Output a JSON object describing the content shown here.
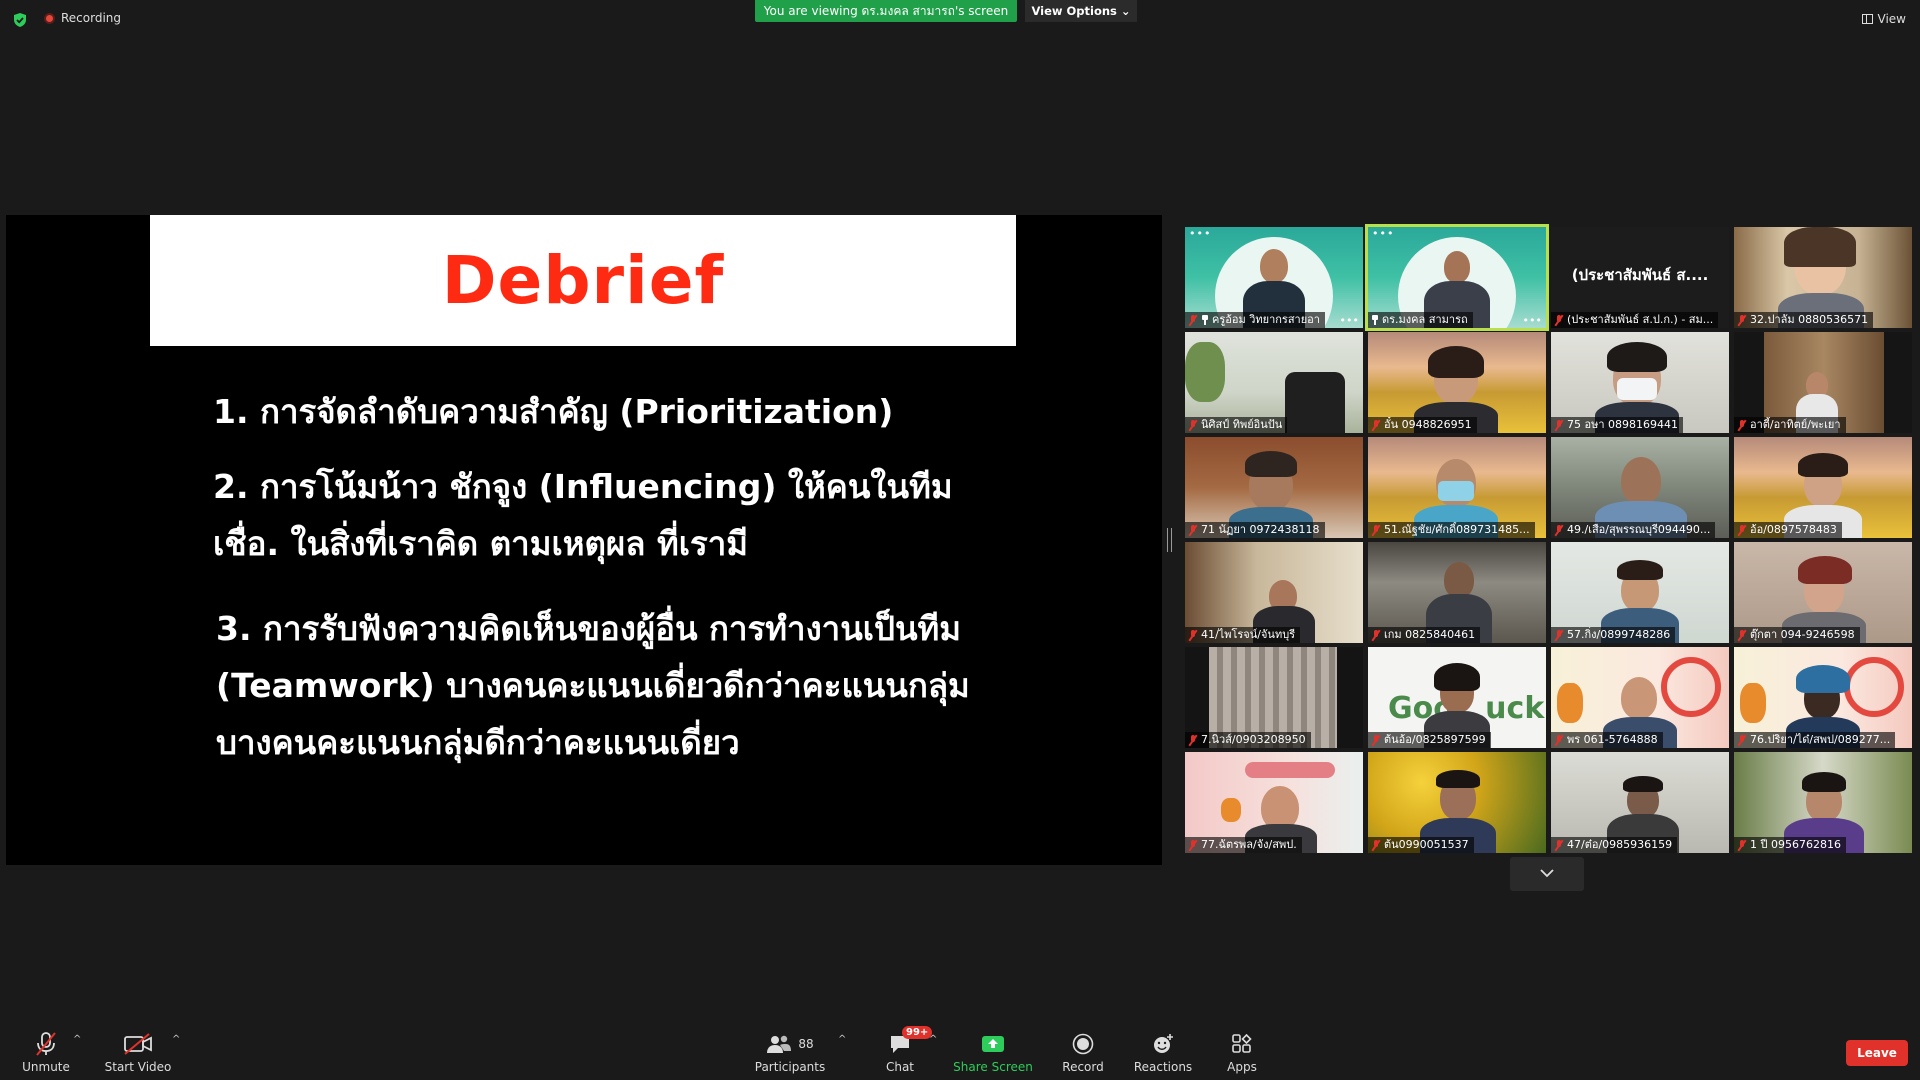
{
  "topbar": {
    "recording_label": "Recording",
    "viewing_text": "You are viewing ดร.มงคล สามารถ's screen",
    "view_options_label": "View Options",
    "view_label": "View"
  },
  "slide": {
    "title": "Debrief",
    "lines": [
      "1. การจัดลำดับความสำคัญ (Prioritization)",
      "2. การโน้มน้าว ชักจูง (Influencing) ให้คนในทีม",
      "เชื่อ. ในสิ่งที่เราคิด ตามเหตุผล ที่เรามี",
      "3. การรับฟังความคิดเห็นของผู้อื่น การทำงานเป็นทีม",
      "(Teamwork) บางคนคะแนนเดี่ยวดีกว่าคะแนนกลุ่ม",
      "บางคนคะแนนกลุ่มดีกว่าคะแนนเดี่ยว"
    ]
  },
  "gallery": {
    "tiles": [
      {
        "name": "ครูอ้อม วิทยากรสายอา"
      },
      {
        "name": "ดร.มงคล สามารถ"
      },
      {
        "name": "(ประชาสัมพันธ์ ส.ป.ก.) - สม...",
        "display_name": "(ประชาสัมพันธ์ ส...."
      },
      {
        "name": "32.ปาลัม 0880536571"
      },
      {
        "name": "นิศิสป์ ทิพย์อินปัน"
      },
      {
        "name": "อั๋น 0948826951"
      },
      {
        "name": "75 อษา 0898169441"
      },
      {
        "name": "อาตี้/อาทิตย์/พะเยา"
      },
      {
        "name": "71 นัฏยา 0972438118"
      },
      {
        "name": "51.ณัฐชัย/ศักดิ์089731485..."
      },
      {
        "name": "49./เสือ/สุพรรณบุรี094490..."
      },
      {
        "name": "อ้อ/0897578483"
      },
      {
        "name": "41/ไพโรจน์/จันทบุรี"
      },
      {
        "name": "เกม 0825840461"
      },
      {
        "name": "57.กิ่ง/0899748286"
      },
      {
        "name": "ตุ๊กตา 094-9246598"
      },
      {
        "name": "7.นิวส์/0903208950"
      },
      {
        "name": "ต้นอ้อ/0825897599"
      },
      {
        "name": "พร 061-5764888"
      },
      {
        "name": "76.ปริยา/ได๋/สพป/089277..."
      },
      {
        "name": "77.ฉัตรพล/จัง/สพป."
      },
      {
        "name": "ต้น0990051537"
      },
      {
        "name": "47/ต๋อ/0985936159"
      },
      {
        "name": "1 ปี 0956762816"
      }
    ]
  },
  "toolbar": {
    "unmute": "Unmute",
    "start_video": "Start Video",
    "participants": "Participants",
    "participants_count": "88",
    "chat": "Chat",
    "chat_badge": "99+",
    "share_screen": "Share Screen",
    "record": "Record",
    "reactions": "Reactions",
    "apps": "Apps",
    "leave": "Leave"
  },
  "icons": [
    "shield-icon",
    "recording-icon",
    "view-icon",
    "mic-off-icon",
    "video-off-icon",
    "participants-icon",
    "chat-icon",
    "share-screen-icon",
    "record-icon",
    "reactions-icon",
    "apps-icon",
    "chevron-down-icon",
    "pin-icon"
  ],
  "colors": {
    "accent_green": "#21a04a",
    "share_green": "#2ecc5a",
    "leave_red": "#e0312a",
    "active_speaker": "#b9e04b",
    "slide_title": "#ff2a12"
  }
}
